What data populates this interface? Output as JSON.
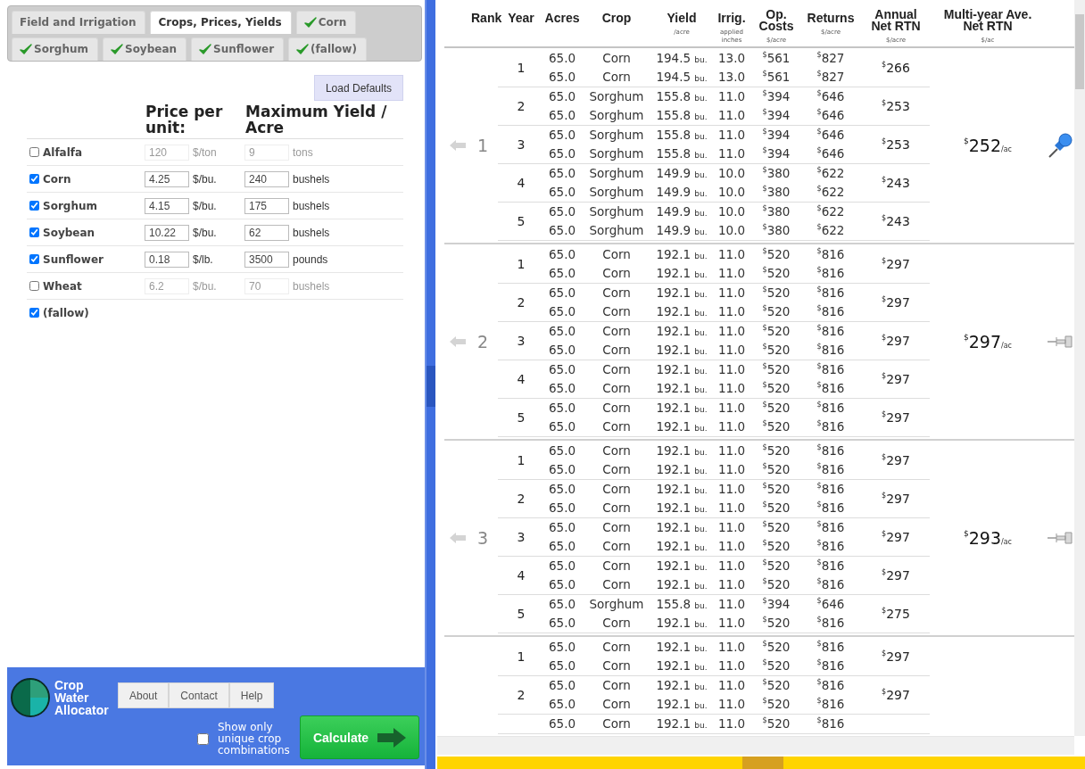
{
  "tabs": [
    {
      "label": "Field and Irrigation",
      "selected": false,
      "checked": false
    },
    {
      "label": "Crops, Prices, Yields",
      "selected": true,
      "checked": false
    },
    {
      "label": "Corn",
      "selected": false,
      "checked": true
    },
    {
      "label": "Sorghum",
      "selected": false,
      "checked": true
    },
    {
      "label": "Soybean",
      "selected": false,
      "checked": true
    },
    {
      "label": "Sunflower",
      "selected": false,
      "checked": true
    },
    {
      "label": "(fallow)",
      "selected": false,
      "checked": true
    }
  ],
  "load_defaults": "Load Defaults",
  "crop_headers": [
    "Price per unit:",
    "Maximum Yield / Acre"
  ],
  "crops": [
    {
      "name": "Alfalfa",
      "checked": false,
      "price": "120",
      "price_unit": "$/ton",
      "max_yield": "9",
      "yield_unit": "tons"
    },
    {
      "name": "Corn",
      "checked": true,
      "price": "4.25",
      "price_unit": "$/bu.",
      "max_yield": "240",
      "yield_unit": "bushels"
    },
    {
      "name": "Sorghum",
      "checked": true,
      "price": "4.15",
      "price_unit": "$/bu.",
      "max_yield": "175",
      "yield_unit": "bushels"
    },
    {
      "name": "Soybean",
      "checked": true,
      "price": "10.22",
      "price_unit": "$/bu.",
      "max_yield": "62",
      "yield_unit": "bushels"
    },
    {
      "name": "Sunflower",
      "checked": true,
      "price": "0.18",
      "price_unit": "$/lb.",
      "max_yield": "3500",
      "yield_unit": "pounds"
    },
    {
      "name": "Wheat",
      "checked": false,
      "price": "6.2",
      "price_unit": "$/bu.",
      "max_yield": "70",
      "yield_unit": "bushels"
    },
    {
      "name": "(fallow)",
      "checked": true
    }
  ],
  "footer": {
    "app_name": "Crop Water Allocator",
    "nav": [
      "About",
      "Contact",
      "Help"
    ],
    "unique_label": "Show only unique crop combinations",
    "unique_only": false,
    "calculate": "Calculate"
  },
  "table": {
    "columns": [
      {
        "title": "Rank"
      },
      {
        "title": "Year"
      },
      {
        "title": "Acres"
      },
      {
        "title": "Crop"
      },
      {
        "title": "Yield",
        "sub": "/acre"
      },
      {
        "title": "Irrig.",
        "sub": "applied inches"
      },
      {
        "title": "Op. Costs",
        "sub": "$/acre"
      },
      {
        "title": "Returns",
        "sub": "$/acre"
      },
      {
        "title": "Annual Net RTN",
        "sub": "$/acre"
      },
      {
        "title": "Multi-year Ave. Net RTN",
        "sub": "$/ac"
      }
    ],
    "results": [
      {
        "rank": "1",
        "average": "$^{$}$252",
        "average_unit": "/ac",
        "pinned": true,
        "years": [
          {
            "year": "1",
            "annual": "$^{$}$266",
            "rows": [
              [
                "65.0",
                "Corn",
                "194.5",
                "bu.",
                "13.0",
                "$^{$}$561",
                "$^{$}$827"
              ],
              [
                "65.0",
                "Corn",
                "194.5",
                "bu.",
                "13.0",
                "$^{$}$561",
                "$^{$}$827"
              ]
            ]
          },
          {
            "year": "2",
            "annual": "$^{$}$253",
            "rows": [
              [
                "65.0",
                "Sorghum",
                "155.8",
                "bu.",
                "11.0",
                "$^{$}$394",
                "$^{$}$646"
              ],
              [
                "65.0",
                "Sorghum",
                "155.8",
                "bu.",
                "11.0",
                "$^{$}$394",
                "$^{$}$646"
              ]
            ]
          },
          {
            "year": "3",
            "annual": "$^{$}$253",
            "rows": [
              [
                "65.0",
                "Sorghum",
                "155.8",
                "bu.",
                "11.0",
                "$^{$}$394",
                "$^{$}$646"
              ],
              [
                "65.0",
                "Sorghum",
                "155.8",
                "bu.",
                "11.0",
                "$^{$}$394",
                "$^{$}$646"
              ]
            ]
          },
          {
            "year": "4",
            "annual": "$^{$}$243",
            "rows": [
              [
                "65.0",
                "Sorghum",
                "149.9",
                "bu.",
                "10.0",
                "$^{$}$380",
                "$^{$}$622"
              ],
              [
                "65.0",
                "Sorghum",
                "149.9",
                "bu.",
                "10.0",
                "$^{$}$380",
                "$^{$}$622"
              ]
            ]
          },
          {
            "year": "5",
            "annual": "$^{$}$243",
            "rows": [
              [
                "65.0",
                "Sorghum",
                "149.9",
                "bu.",
                "10.0",
                "$^{$}$380",
                "$^{$}$622"
              ],
              [
                "65.0",
                "Sorghum",
                "149.9",
                "bu.",
                "10.0",
                "$^{$}$380",
                "$^{$}$622"
              ]
            ]
          }
        ]
      },
      {
        "rank": "2",
        "average": "$^{$}$297",
        "average_unit": "/ac",
        "pinned": false,
        "years": [
          {
            "year": "1",
            "annual": "$^{$}$297",
            "rows": [
              [
                "65.0",
                "Corn",
                "192.1",
                "bu.",
                "11.0",
                "$^{$}$520",
                "$^{$}$816"
              ],
              [
                "65.0",
                "Corn",
                "192.1",
                "bu.",
                "11.0",
                "$^{$}$520",
                "$^{$}$816"
              ]
            ]
          },
          {
            "year": "2",
            "annual": "$^{$}$297",
            "rows": [
              [
                "65.0",
                "Corn",
                "192.1",
                "bu.",
                "11.0",
                "$^{$}$520",
                "$^{$}$816"
              ],
              [
                "65.0",
                "Corn",
                "192.1",
                "bu.",
                "11.0",
                "$^{$}$520",
                "$^{$}$816"
              ]
            ]
          },
          {
            "year": "3",
            "annual": "$^{$}$297",
            "rows": [
              [
                "65.0",
                "Corn",
                "192.1",
                "bu.",
                "11.0",
                "$^{$}$520",
                "$^{$}$816"
              ],
              [
                "65.0",
                "Corn",
                "192.1",
                "bu.",
                "11.0",
                "$^{$}$520",
                "$^{$}$816"
              ]
            ]
          },
          {
            "year": "4",
            "annual": "$^{$}$297",
            "rows": [
              [
                "65.0",
                "Corn",
                "192.1",
                "bu.",
                "11.0",
                "$^{$}$520",
                "$^{$}$816"
              ],
              [
                "65.0",
                "Corn",
                "192.1",
                "bu.",
                "11.0",
                "$^{$}$520",
                "$^{$}$816"
              ]
            ]
          },
          {
            "year": "5",
            "annual": "$^{$}$297",
            "rows": [
              [
                "65.0",
                "Corn",
                "192.1",
                "bu.",
                "11.0",
                "$^{$}$520",
                "$^{$}$816"
              ],
              [
                "65.0",
                "Corn",
                "192.1",
                "bu.",
                "11.0",
                "$^{$}$520",
                "$^{$}$816"
              ]
            ]
          }
        ]
      },
      {
        "rank": "3",
        "average": "$^{$}$293",
        "average_unit": "/ac",
        "pinned": false,
        "years": [
          {
            "year": "1",
            "annual": "$^{$}$297",
            "rows": [
              [
                "65.0",
                "Corn",
                "192.1",
                "bu.",
                "11.0",
                "$^{$}$520",
                "$^{$}$816"
              ],
              [
                "65.0",
                "Corn",
                "192.1",
                "bu.",
                "11.0",
                "$^{$}$520",
                "$^{$}$816"
              ]
            ]
          },
          {
            "year": "2",
            "annual": "$^{$}$297",
            "rows": [
              [
                "65.0",
                "Corn",
                "192.1",
                "bu.",
                "11.0",
                "$^{$}$520",
                "$^{$}$816"
              ],
              [
                "65.0",
                "Corn",
                "192.1",
                "bu.",
                "11.0",
                "$^{$}$520",
                "$^{$}$816"
              ]
            ]
          },
          {
            "year": "3",
            "annual": "$^{$}$297",
            "rows": [
              [
                "65.0",
                "Corn",
                "192.1",
                "bu.",
                "11.0",
                "$^{$}$520",
                "$^{$}$816"
              ],
              [
                "65.0",
                "Corn",
                "192.1",
                "bu.",
                "11.0",
                "$^{$}$520",
                "$^{$}$816"
              ]
            ]
          },
          {
            "year": "4",
            "annual": "$^{$}$297",
            "rows": [
              [
                "65.0",
                "Corn",
                "192.1",
                "bu.",
                "11.0",
                "$^{$}$520",
                "$^{$}$816"
              ],
              [
                "65.0",
                "Corn",
                "192.1",
                "bu.",
                "11.0",
                "$^{$}$520",
                "$^{$}$816"
              ]
            ]
          },
          {
            "year": "5",
            "annual": "$^{$}$275",
            "rows": [
              [
                "65.0",
                "Sorghum",
                "155.8",
                "bu.",
                "11.0",
                "$^{$}$394",
                "$^{$}$646"
              ],
              [
                "65.0",
                "Corn",
                "192.1",
                "bu.",
                "11.0",
                "$^{$}$520",
                "$^{$}$816"
              ]
            ]
          }
        ]
      },
      {
        "years": [
          {
            "year": "1",
            "annual": "$^{$}$297",
            "rows": [
              [
                "65.0",
                "Corn",
                "192.1",
                "bu.",
                "11.0",
                "$^{$}$520",
                "$^{$}$816"
              ],
              [
                "65.0",
                "Corn",
                "192.1",
                "bu.",
                "11.0",
                "$^{$}$520",
                "$^{$}$816"
              ]
            ]
          },
          {
            "year": "2",
            "annual": "$^{$}$297",
            "rows": [
              [
                "65.0",
                "Corn",
                "192.1",
                "bu.",
                "11.0",
                "$^{$}$520",
                "$^{$}$816"
              ],
              [
                "65.0",
                "Corn",
                "192.1",
                "bu.",
                "11.0",
                "$^{$}$520",
                "$^{$}$816"
              ]
            ]
          },
          {
            "rows": [
              [
                "65.0",
                "Corn",
                "192.1",
                "bu.",
                "11.0",
                "$^{$}$520",
                "$^{$}$816"
              ]
            ]
          }
        ]
      }
    ]
  }
}
